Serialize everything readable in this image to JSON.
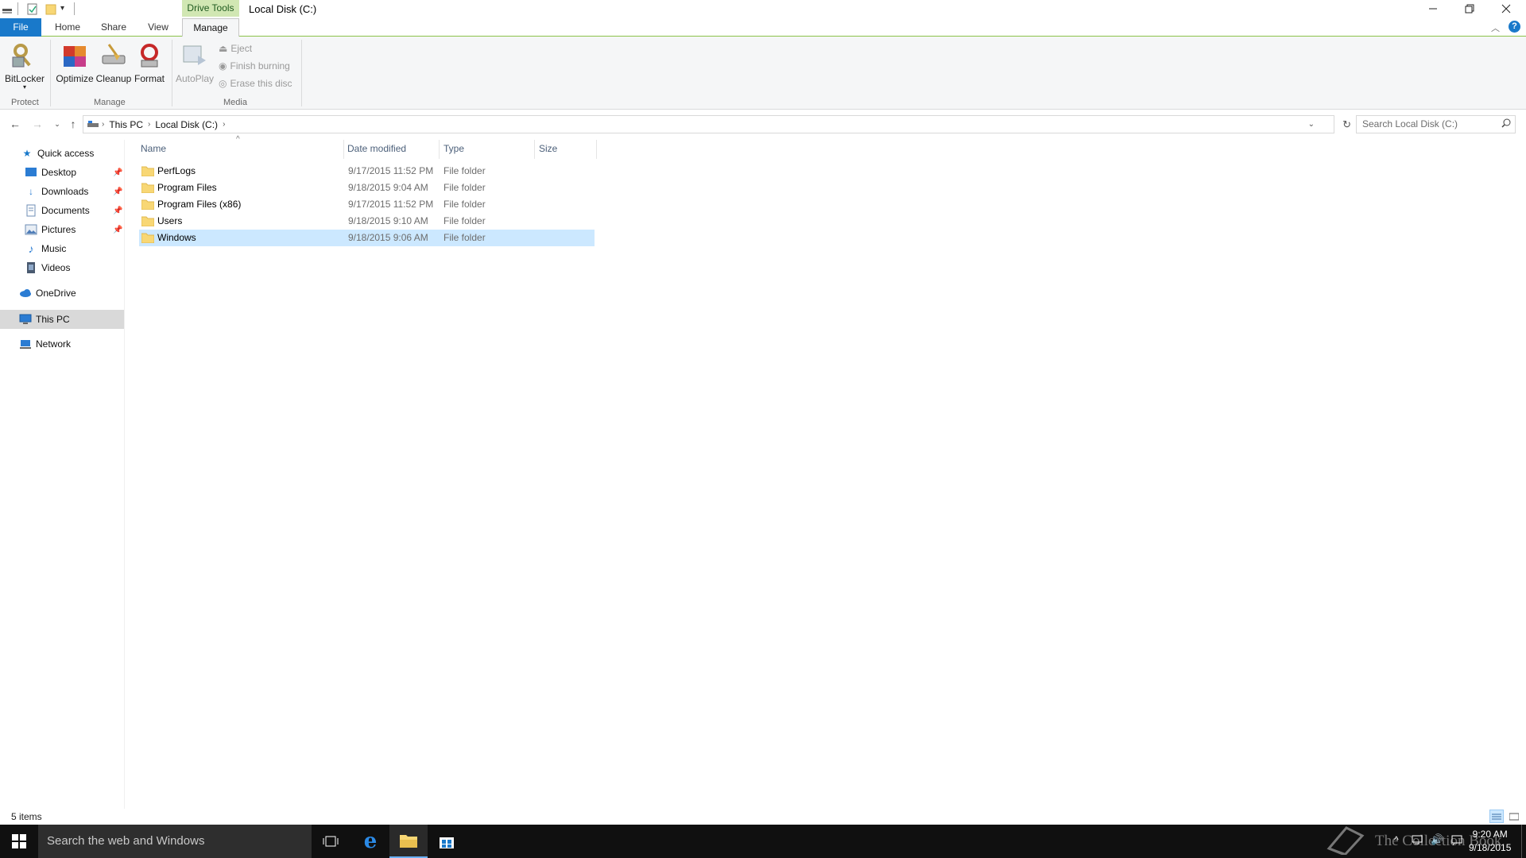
{
  "window": {
    "title": "Local Disk (C:)",
    "context_tab": "Drive Tools"
  },
  "ribbon": {
    "tabs": [
      "File",
      "Home",
      "Share",
      "View",
      "Manage"
    ],
    "protect": {
      "label": "Protect",
      "bitlocker": "BitLocker"
    },
    "manage": {
      "label": "Manage",
      "optimize": "Optimize",
      "cleanup": "Cleanup",
      "format": "Format"
    },
    "media": {
      "label": "Media",
      "autoplay": "AutoPlay",
      "eject": "Eject",
      "finish_burning": "Finish burning",
      "erase_disc": "Erase this disc"
    }
  },
  "address": {
    "breadcrumbs": [
      "This PC",
      "Local Disk (C:)"
    ],
    "search_placeholder": "Search Local Disk (C:)"
  },
  "nav": {
    "quick_access": "Quick access",
    "items": [
      "Desktop",
      "Downloads",
      "Documents",
      "Pictures",
      "Music",
      "Videos"
    ],
    "onedrive": "OneDrive",
    "this_pc": "This PC",
    "network": "Network"
  },
  "columns": {
    "name": "Name",
    "date": "Date modified",
    "type": "Type",
    "size": "Size"
  },
  "files": [
    {
      "name": "PerfLogs",
      "date": "9/17/2015 11:52 PM",
      "type": "File folder"
    },
    {
      "name": "Program Files",
      "date": "9/18/2015 9:04 AM",
      "type": "File folder"
    },
    {
      "name": "Program Files (x86)",
      "date": "9/17/2015 11:52 PM",
      "type": "File folder"
    },
    {
      "name": "Users",
      "date": "9/18/2015 9:10 AM",
      "type": "File folder"
    },
    {
      "name": "Windows",
      "date": "9/18/2015 9:06 AM",
      "type": "File folder"
    }
  ],
  "status": {
    "count": "5 items"
  },
  "taskbar": {
    "search_text": "Search the web and Windows",
    "time": "9:20 AM",
    "date": "9/18/2015",
    "watermark": "The Collection Book"
  },
  "colors": {
    "accent": "#1979ca",
    "selection": "#cce8ff",
    "context_tab": "#d1e7b3",
    "folder": "#f8d775"
  }
}
